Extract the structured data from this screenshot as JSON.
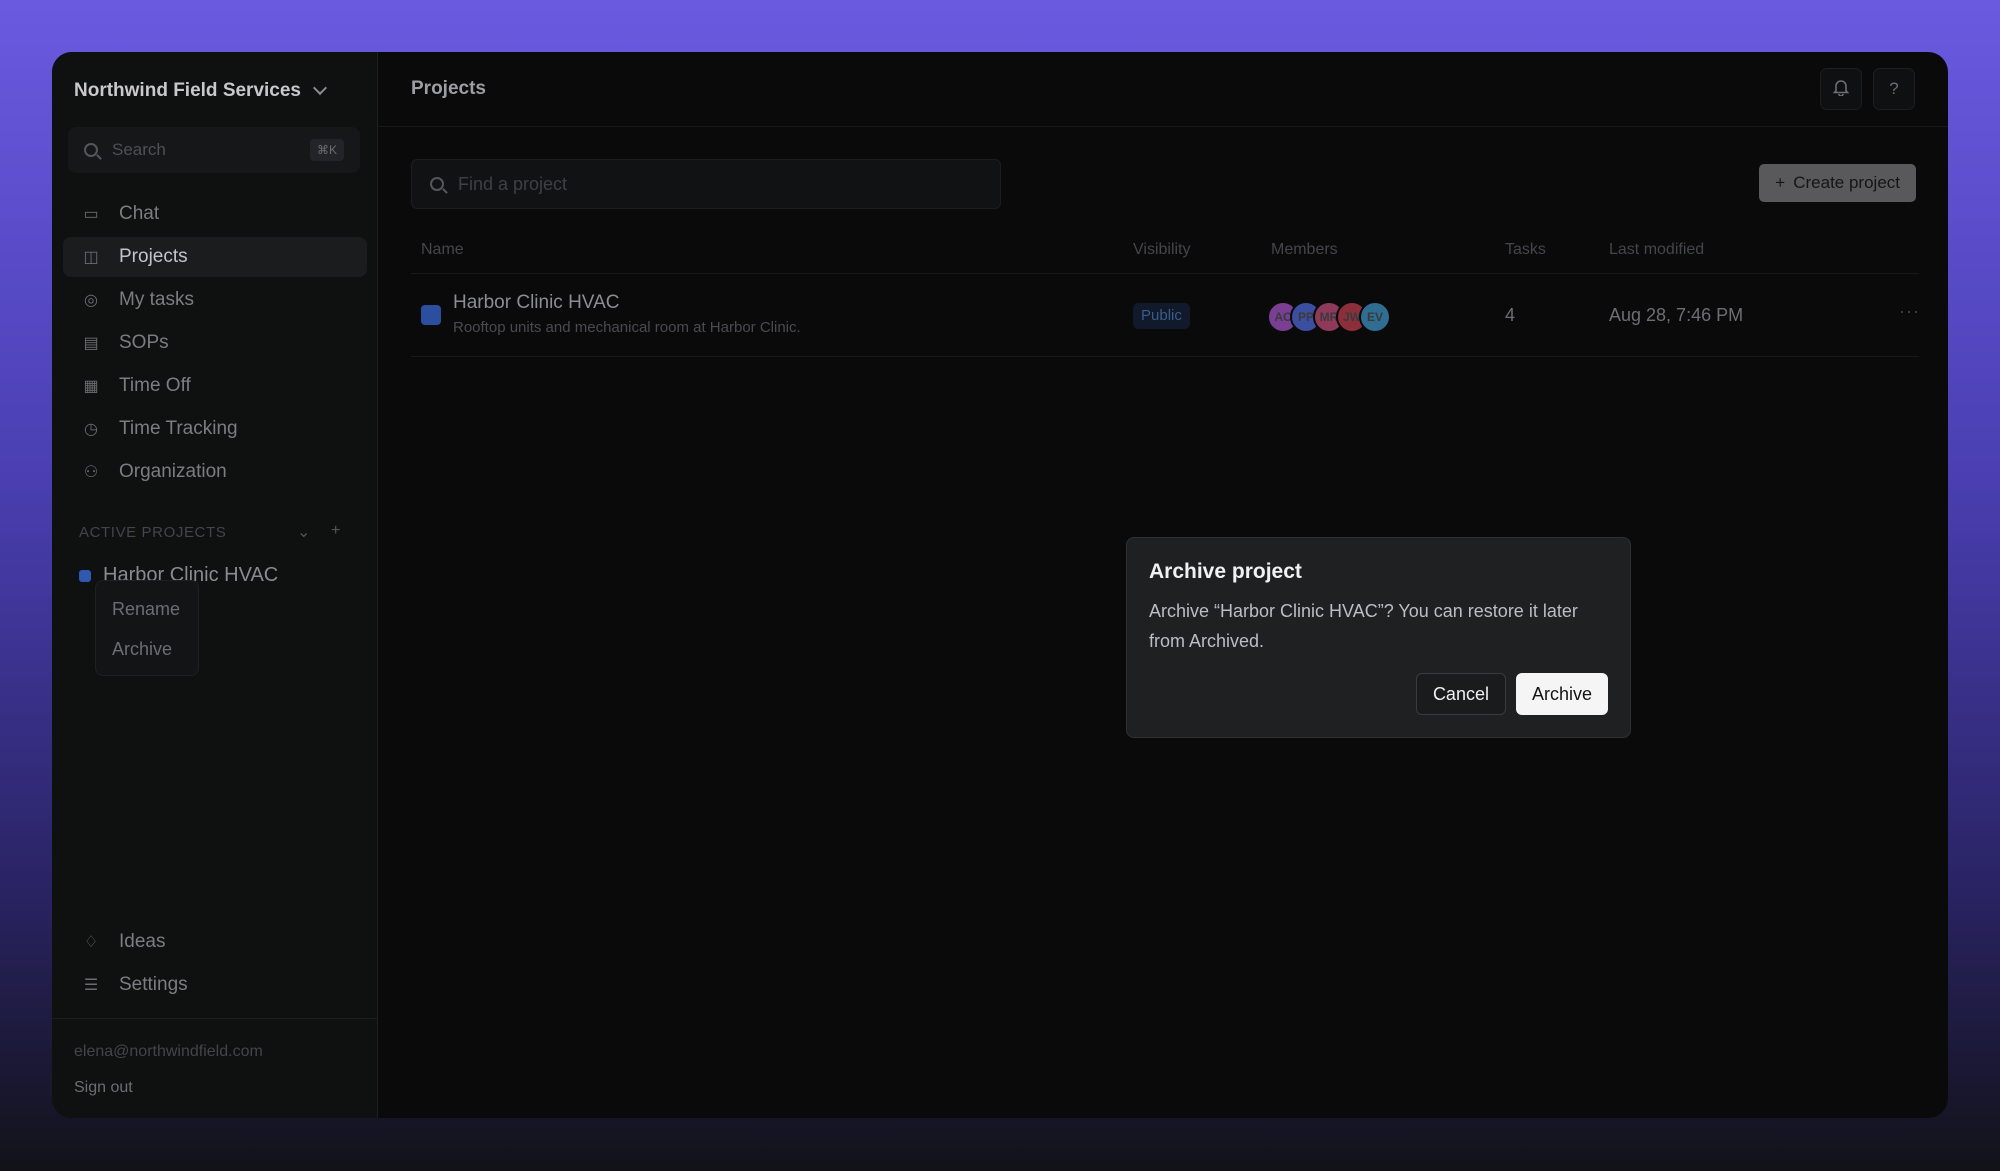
{
  "org": {
    "name": "Northwind Field Services"
  },
  "sidebar": {
    "search_placeholder": "Search",
    "search_shortcut": "⌘K",
    "items": [
      {
        "label": "Chat",
        "icon": "chat-icon",
        "active": false
      },
      {
        "label": "Projects",
        "icon": "projects-icon",
        "active": true
      },
      {
        "label": "My tasks",
        "icon": "check-circle-icon",
        "active": false
      },
      {
        "label": "SOPs",
        "icon": "document-icon",
        "active": false
      },
      {
        "label": "Time Off",
        "icon": "calendar-icon",
        "active": false
      },
      {
        "label": "Time Tracking",
        "icon": "timer-icon",
        "active": false
      },
      {
        "label": "Organization",
        "icon": "people-icon",
        "active": false
      }
    ],
    "active_projects_label": "ACTIVE PROJECTS",
    "active_projects": [
      {
        "label": "Harbor Clinic HVAC",
        "color": "#2f58b0"
      }
    ],
    "context_menu": [
      "Rename",
      "Archive"
    ],
    "bottom_items": [
      {
        "label": "Ideas",
        "icon": "lightbulb-icon"
      },
      {
        "label": "Settings",
        "icon": "sliders-icon"
      }
    ],
    "user_email": "elena@northwindfield.com",
    "sign_out": "Sign out"
  },
  "header": {
    "title": "Projects",
    "notification_icon": "bell-icon",
    "help_label": "?"
  },
  "main": {
    "find_placeholder": "Find a project",
    "create_label": "Create project",
    "columns": [
      "Name",
      "Visibility",
      "Members",
      "Tasks",
      "Last modified"
    ],
    "rows": [
      {
        "name": "Harbor Clinic HVAC",
        "description": "Rooftop units and mechanical room at Harbor Clinic.",
        "visibility": "Public",
        "members": [
          {
            "initials": "AC",
            "color": "#7a3f93"
          },
          {
            "initials": "PP",
            "color": "#3c4ea0"
          },
          {
            "initials": "MR",
            "color": "#8f3a5b"
          },
          {
            "initials": "JW",
            "color": "#8c2f3a"
          },
          {
            "initials": "EV",
            "color": "#2f6e92"
          }
        ],
        "tasks": "4",
        "last_modified": "Aug 28, 7:46 PM",
        "more": "···"
      }
    ]
  },
  "dialog": {
    "title": "Archive project",
    "message": "Archive “Harbor Clinic HVAC”? You can restore it later from Archived.",
    "cancel_label": "Cancel",
    "confirm_label": "Archive"
  }
}
